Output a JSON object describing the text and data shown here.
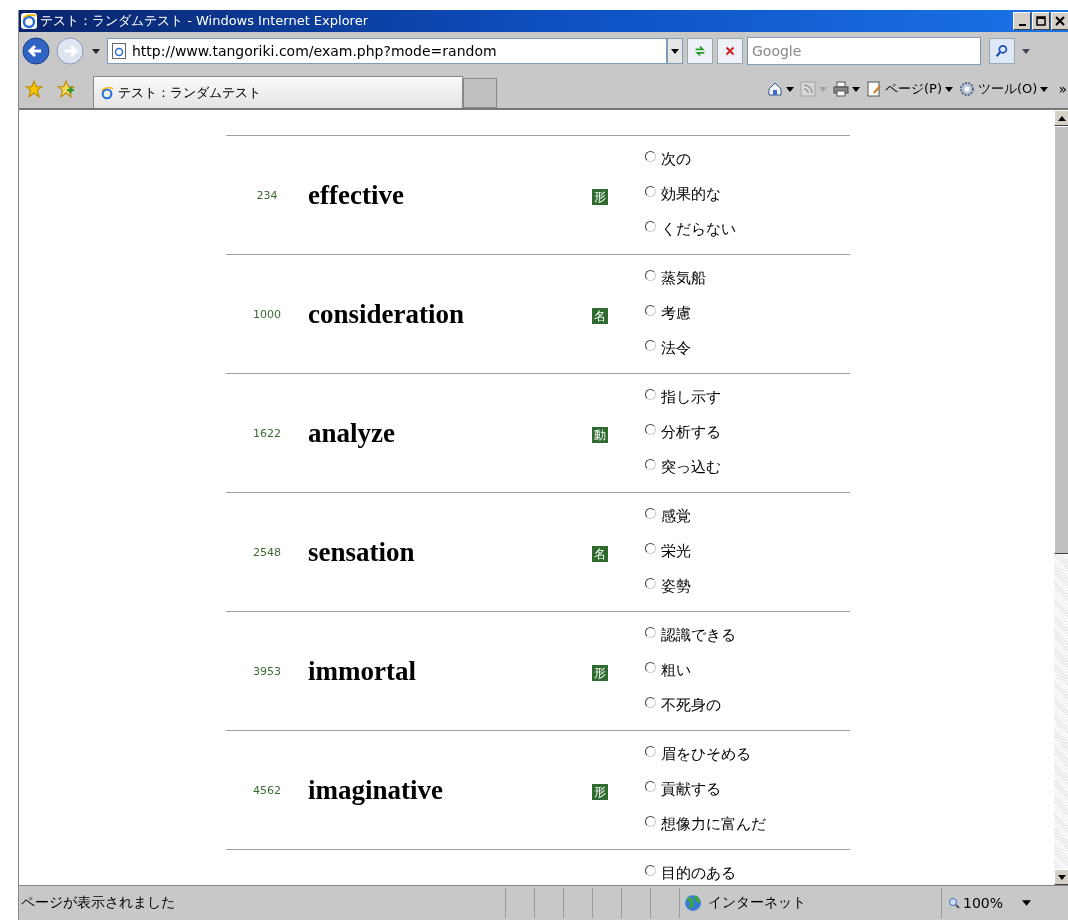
{
  "window": {
    "title": "テスト：ランダムテスト - Windows Internet Explorer"
  },
  "address_bar": {
    "url": "http://www.tangoriki.com/exam.php?mode=random"
  },
  "search": {
    "placeholder": "Google"
  },
  "tabs": [
    {
      "label": "テスト：ランダムテスト",
      "selected": true
    }
  ],
  "toolbar": {
    "page_menu": "ページ(P)",
    "tools_menu": "ツール(O)",
    "overflow": "»"
  },
  "questions": [
    {
      "number": "234",
      "word": "effective",
      "pos": "形",
      "options": [
        {
          "label": "次の",
          "selected": false
        },
        {
          "label": "効果的な",
          "selected": false
        },
        {
          "label": "くだらない",
          "selected": false
        }
      ]
    },
    {
      "number": "1000",
      "word": "consideration",
      "pos": "名",
      "options": [
        {
          "label": "蒸気船",
          "selected": false
        },
        {
          "label": "考慮",
          "selected": false
        },
        {
          "label": "法令",
          "selected": false
        }
      ]
    },
    {
      "number": "1622",
      "word": "analyze",
      "pos": "動",
      "options": [
        {
          "label": "指し示す",
          "selected": false
        },
        {
          "label": "分析する",
          "selected": false
        },
        {
          "label": "突っ込む",
          "selected": false
        }
      ]
    },
    {
      "number": "2548",
      "word": "sensation",
      "pos": "名",
      "options": [
        {
          "label": "感覚",
          "selected": false
        },
        {
          "label": "栄光",
          "selected": false
        },
        {
          "label": "姿勢",
          "selected": false
        }
      ]
    },
    {
      "number": "3953",
      "word": "immortal",
      "pos": "形",
      "options": [
        {
          "label": "認識できる",
          "selected": false
        },
        {
          "label": "粗い",
          "selected": false
        },
        {
          "label": "不死身の",
          "selected": false
        }
      ]
    },
    {
      "number": "4562",
      "word": "imaginative",
      "pos": "形",
      "options": [
        {
          "label": "眉をひそめる",
          "selected": false
        },
        {
          "label": "貢献する",
          "selected": false
        },
        {
          "label": "想像力に富んだ",
          "selected": false
        }
      ]
    },
    {
      "options": [
        {
          "label": "目的のある",
          "selected": false
        }
      ]
    }
  ],
  "status_bar": {
    "text": "ページが表示されました",
    "zone": "インターネット",
    "zoom": "100%"
  }
}
